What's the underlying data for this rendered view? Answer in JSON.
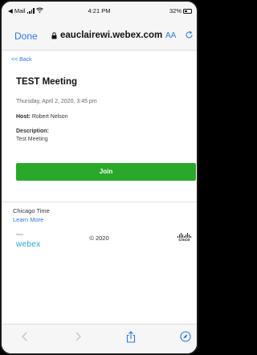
{
  "status_bar": {
    "carrier": "◀ Mail",
    "time": "4:21 PM",
    "battery_text": "32%",
    "battery_level_percent": 32
  },
  "browser": {
    "done_label": "Done",
    "url": "eauclairewi.webex.com",
    "text_size_label": "AA"
  },
  "page": {
    "back_link": "<< Back",
    "meeting_title": "TEST Meeting",
    "date_time": "Thursday, April 2, 2020, 3:45 pm",
    "host_label": "Host:",
    "host_name": "Robert Nelson",
    "description_label": "Description:",
    "description_value": "Test Meeting",
    "join_label": "Join",
    "join_color": "#2aa82a"
  },
  "footer": {
    "timezone": "Chicago Time",
    "learn_more": "Learn More",
    "webex_small": "Cisco",
    "webex_word": "webex",
    "copyright": "© 2020",
    "cisco_word": "cisco"
  },
  "colors": {
    "accent_blue": "#2a7ae2",
    "webex_blue": "#2ba0d8"
  },
  "icons": {
    "lock": "lock-icon",
    "reload": "reload-icon",
    "back": "chevron-left-icon",
    "forward": "chevron-right-icon",
    "share": "share-icon",
    "compass": "compass-icon"
  }
}
